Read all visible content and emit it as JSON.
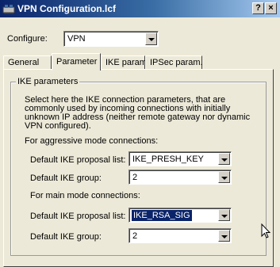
{
  "window": {
    "title": "VPN Configuration.lcf",
    "help_label": "?",
    "close_label": "×"
  },
  "configure": {
    "label": "Configure:",
    "value": "VPN"
  },
  "tabs": [
    {
      "label": "General"
    },
    {
      "label": "Parameter"
    },
    {
      "label": "IKE param."
    },
    {
      "label": "IPSec param."
    }
  ],
  "ike_group": {
    "title": "IKE parameters",
    "description": "Select here the IKE connection parameters, that are commonly used by incoming connections with initially unknown IP address (neither remote gateway nor dynamic VPN configured).",
    "aggressive": {
      "heading": "For aggressive mode connections:",
      "proposal_label": "Default IKE proposal list:",
      "proposal_value": "IKE_PRESH_KEY",
      "group_label": "Default IKE group:",
      "group_value": "2"
    },
    "main": {
      "heading": "For main mode connections:",
      "proposal_label": "Default IKE proposal list:",
      "proposal_value": "IKE_RSA_SIG",
      "group_label": "Default IKE group:",
      "group_value": "2"
    }
  }
}
